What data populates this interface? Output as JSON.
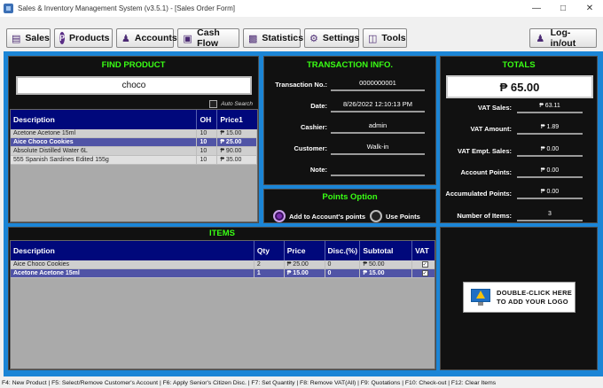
{
  "window": {
    "title": "Sales & Inventory Management System (v3.5.1) - [Sales Order Form]"
  },
  "menu": [
    {
      "label": "Sales",
      "icon": "sales-icon"
    },
    {
      "label": "Products",
      "icon": "products-icon"
    },
    {
      "label": "Accounts",
      "icon": "accounts-icon"
    },
    {
      "label": "Cash Flow",
      "icon": "cash-flow-icon"
    },
    {
      "label": "Statistics",
      "icon": "statistics-icon"
    },
    {
      "label": "Settings",
      "icon": "settings-icon"
    },
    {
      "label": "Tools",
      "icon": "tools-icon"
    },
    {
      "label": "Log-in/out",
      "icon": "login-icon"
    }
  ],
  "find_product": {
    "title": "FIND PRODUCT",
    "search_value": "choco",
    "auto_search_label": "Auto Search",
    "columns": [
      "Description",
      "OH",
      "Price1"
    ],
    "rows": [
      {
        "description": "Acetone Acetone 15ml",
        "oh": "10",
        "price": "₱ 15.00"
      },
      {
        "description": "Aice Choco Cookies",
        "oh": "10",
        "price": "₱ 25.00"
      },
      {
        "description": "Absolute Distilled Water 6L",
        "oh": "10",
        "price": "₱ 90.00"
      },
      {
        "description": "555 Spanish Sardines Edited 155g",
        "oh": "10",
        "price": "₱ 35.00"
      }
    ],
    "selected_row": 1
  },
  "transaction": {
    "title": "TRANSACTION INFO.",
    "fields": [
      {
        "label": "Transaction No.:",
        "value": "0000000001"
      },
      {
        "label": "Date:",
        "value": "8/26/2022 12:10:13 PM"
      },
      {
        "label": "Cashier:",
        "value": "admin"
      },
      {
        "label": "Customer:",
        "value": "Walk-in"
      },
      {
        "label": "Note:",
        "value": ""
      }
    ]
  },
  "points_option": {
    "title": "Points Option",
    "add_label": "Add to Account's points",
    "use_label": "Use Points",
    "selected": "add"
  },
  "totals": {
    "title": "TOTALS",
    "total": "₱ 65.00",
    "rows": [
      {
        "label": "VAT Sales:",
        "value": "₱ 63.11"
      },
      {
        "label": "VAT Amount:",
        "value": "₱ 1.89"
      },
      {
        "label": "VAT Empt. Sales:",
        "value": "₱ 0.00"
      },
      {
        "label": "Account Points:",
        "value": "₱ 0.00"
      },
      {
        "label": "Accumulated Points:",
        "value": "₱ 0.00"
      },
      {
        "label": "Number of Items:",
        "value": "3"
      }
    ]
  },
  "items": {
    "title": "ITEMS",
    "columns": [
      "Description",
      "Qty",
      "Price",
      "Disc.(%)",
      "Subtotal",
      "VAT"
    ],
    "rows": [
      {
        "description": "Aice Choco Cookies",
        "qty": "2",
        "price": "₱ 25.00",
        "disc": "0",
        "subtotal": "₱ 50.00",
        "vat": "✓"
      },
      {
        "description": "Acetone Acetone 15ml",
        "qty": "1",
        "price": "₱ 15.00",
        "disc": "0",
        "subtotal": "₱ 15.00",
        "vat": "✓"
      }
    ],
    "selected_row": 1
  },
  "logo": {
    "line1": "DOUBLE-CLICK HERE",
    "line2": "TO ADD YOUR LOGO"
  },
  "statusbar": {
    "text": "F4: New Product | F5: Select/Remove Customer's Account | F6: Apply Senior's Citizen Disc. | F7: Set Quantity | F8: Remove VAT(All) | F9: Quotations | F10: Check-out | F12: Clear Items"
  },
  "colors": {
    "accent_green": "#39ff14",
    "header_blue": "#00087b",
    "frame_blue": "#1b85d6",
    "selected_row": "#5054a6"
  }
}
